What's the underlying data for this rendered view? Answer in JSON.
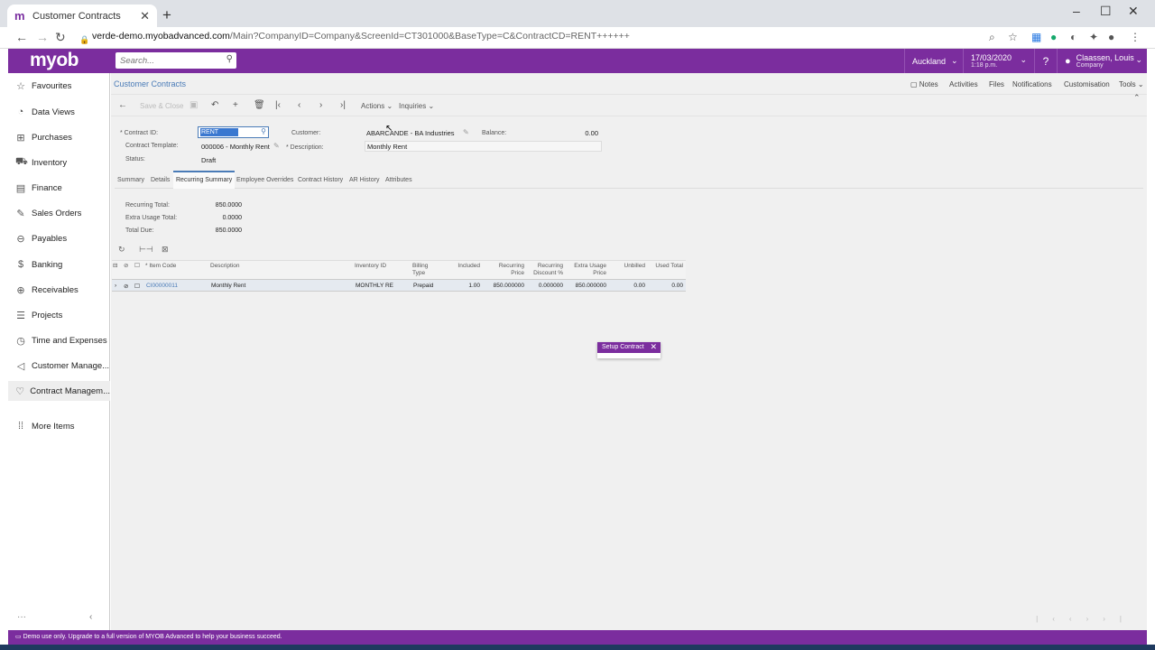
{
  "browser": {
    "tab_title": "Customer Contracts",
    "url_host": "verde-demo.myobadvanced.com",
    "url_path": "/Main?CompanyID=Company&ScreenId=CT301000&BaseType=C&ContractCD=RENT++++++"
  },
  "header": {
    "logo": "myob",
    "search_placeholder": "Search...",
    "branch": "Auckland",
    "date": "17/03/2020",
    "time": "1:18 p.m.",
    "user_name": "Claassen, Louis",
    "user_company": "Company"
  },
  "sidebar": {
    "items": [
      {
        "label": "Favourites",
        "icon": "star-icon"
      },
      {
        "label": "Data Views",
        "icon": "chart-icon"
      },
      {
        "label": "Purchases",
        "icon": "cart-icon"
      },
      {
        "label": "Inventory",
        "icon": "truck-icon"
      },
      {
        "label": "Finance",
        "icon": "calculator-icon"
      },
      {
        "label": "Sales Orders",
        "icon": "pencil-icon"
      },
      {
        "label": "Payables",
        "icon": "minus-circle-icon"
      },
      {
        "label": "Banking",
        "icon": "dollar-icon"
      },
      {
        "label": "Receivables",
        "icon": "plus-circle-icon"
      },
      {
        "label": "Projects",
        "icon": "stack-icon"
      },
      {
        "label": "Time and Expenses",
        "icon": "stopwatch-icon"
      },
      {
        "label": "Customer Manage...",
        "icon": "megaphone-icon"
      },
      {
        "label": "Contract Managem...",
        "icon": "handshake-icon"
      },
      {
        "label": "More Items",
        "icon": "grid-icon"
      }
    ]
  },
  "page": {
    "breadcrumb": "Customer Contracts",
    "top_links": [
      "Notes",
      "Activities",
      "Files",
      "Notifications",
      "Customisation",
      "Tools"
    ],
    "toolbar": {
      "save_close": "Save & Close",
      "actions": "Actions",
      "inquiries": "Inquiries"
    }
  },
  "form": {
    "contract_id_label": "Contract ID:",
    "contract_id": "RENT",
    "contract_template_label": "Contract Template:",
    "contract_template": "000006 - Monthly Rent",
    "status_label": "Status:",
    "status": "Draft",
    "customer_label": "Customer:",
    "customer": "ABARCANDE - BA Industries",
    "description_label": "Description:",
    "description": "Monthly Rent",
    "balance_label": "Balance:",
    "balance": "0.00"
  },
  "tabs": [
    "Summary",
    "Details",
    "Recurring Summary",
    "Employee Overrides",
    "Contract History",
    "AR History",
    "Attributes"
  ],
  "totals": {
    "recurring_total_label": "Recurring Total:",
    "recurring_total": "850.0000",
    "extra_usage_total_label": "Extra Usage Total:",
    "extra_usage_total": "0.0000",
    "total_due_label": "Total Due:",
    "total_due": "850.0000"
  },
  "grid": {
    "headers": {
      "item_code": "Item Code",
      "description": "Description",
      "inventory_id": "Inventory ID",
      "billing_type_1": "Billing",
      "billing_type_2": "Type",
      "included": "Included",
      "recurring_price_1": "Recurring",
      "recurring_price_2": "Price",
      "recurring_discount_1": "Recurring",
      "recurring_discount_2": "Discount %",
      "extra_usage_price_1": "Extra Usage",
      "extra_usage_price_2": "Price",
      "unbilled": "Unbilled",
      "used_total": "Used Total"
    },
    "rows": [
      {
        "item_code": "CI00000011",
        "description": "Monthly Rent",
        "inventory_id": "MONTHLY RE",
        "billing_type": "Prepaid",
        "included": "1.00",
        "recurring_price": "850.000000",
        "recurring_discount": "0.000000",
        "extra_usage_price": "850.000000",
        "unbilled": "0.00",
        "used_total": "0.00"
      }
    ]
  },
  "popup": {
    "title": "Setup Contract"
  },
  "status_bar": "Demo use only. Upgrade to a full version of MYOB Advanced to help your business succeed.",
  "colors": {
    "brand": "#7b2d9e",
    "link": "#4a7bb7"
  }
}
